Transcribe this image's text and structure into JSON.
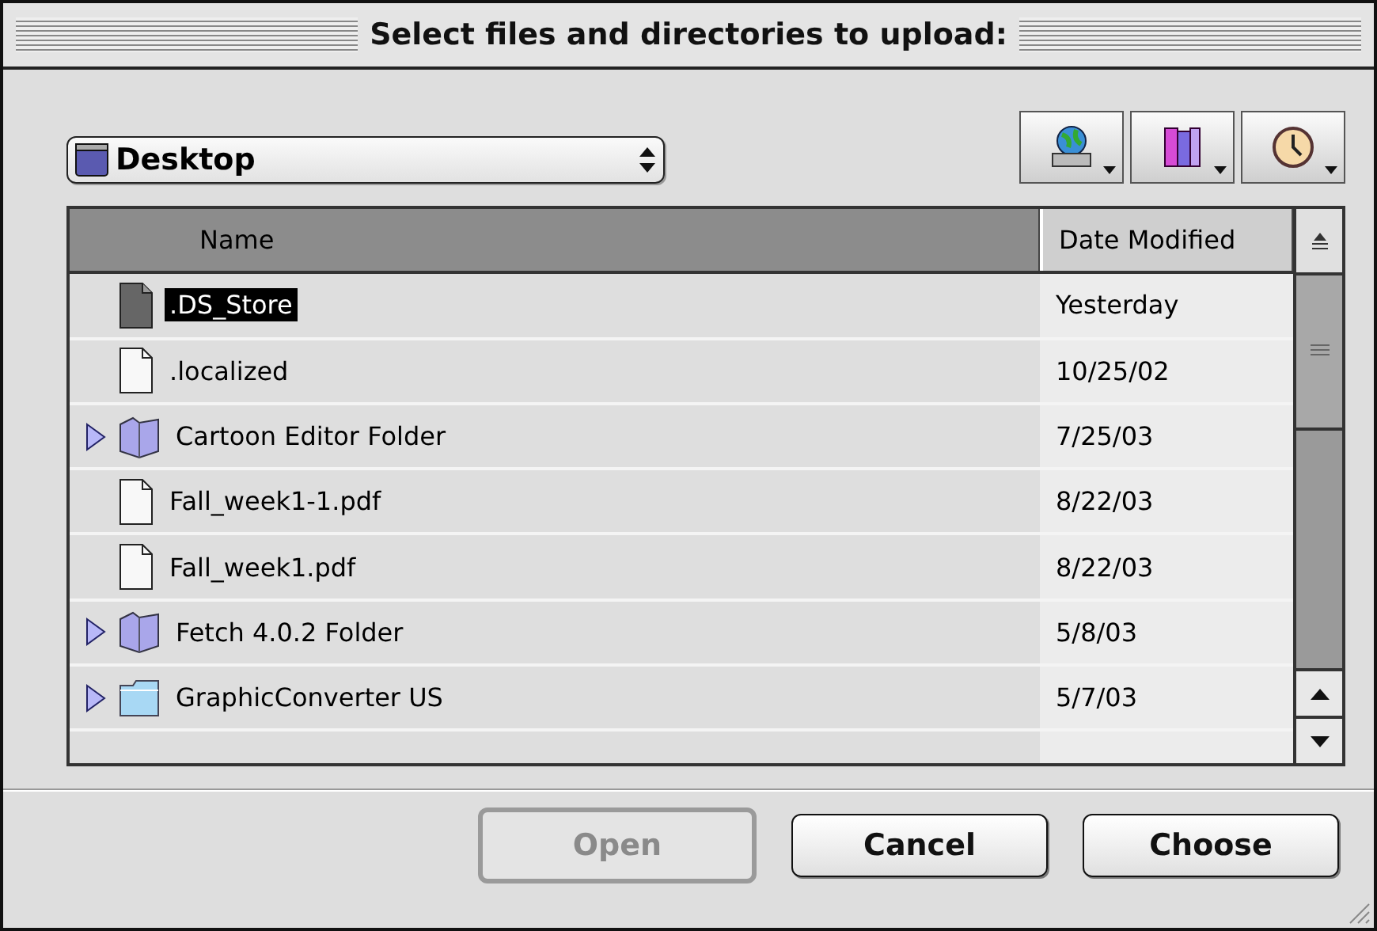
{
  "window": {
    "title": "Select files and directories to upload:"
  },
  "location": {
    "value": "Desktop"
  },
  "toolbar": [
    {
      "kind": "network"
    },
    {
      "kind": "favorites"
    },
    {
      "kind": "recent"
    }
  ],
  "table": {
    "columns": [
      {
        "label": "Name",
        "selected": true
      },
      {
        "label": "Date Modified",
        "selected": false
      }
    ],
    "rows": [
      {
        "kind": "file-dark",
        "name": ".DS_Store",
        "date": "Yesterday",
        "selected": true
      },
      {
        "kind": "file",
        "name": ".localized",
        "date": "10/25/02",
        "selected": false
      },
      {
        "kind": "folder",
        "name": "Cartoon Editor Folder",
        "date": "7/25/03",
        "selected": false,
        "expanded": false
      },
      {
        "kind": "file",
        "name": "Fall_week1-1.pdf",
        "date": "8/22/03",
        "selected": false
      },
      {
        "kind": "file",
        "name": "Fall_week1.pdf",
        "date": "8/22/03",
        "selected": false
      },
      {
        "kind": "folder",
        "name": "Fetch 4.0.2 Folder",
        "date": "5/8/03",
        "selected": false,
        "expanded": false
      },
      {
        "kind": "app-folder",
        "name": "GraphicConverter US",
        "date": "5/7/03",
        "selected": false,
        "expanded": false
      }
    ]
  },
  "buttons": [
    {
      "label": "Open",
      "disabled": true
    },
    {
      "label": "Cancel",
      "disabled": false
    },
    {
      "label": "Choose",
      "disabled": false
    }
  ]
}
